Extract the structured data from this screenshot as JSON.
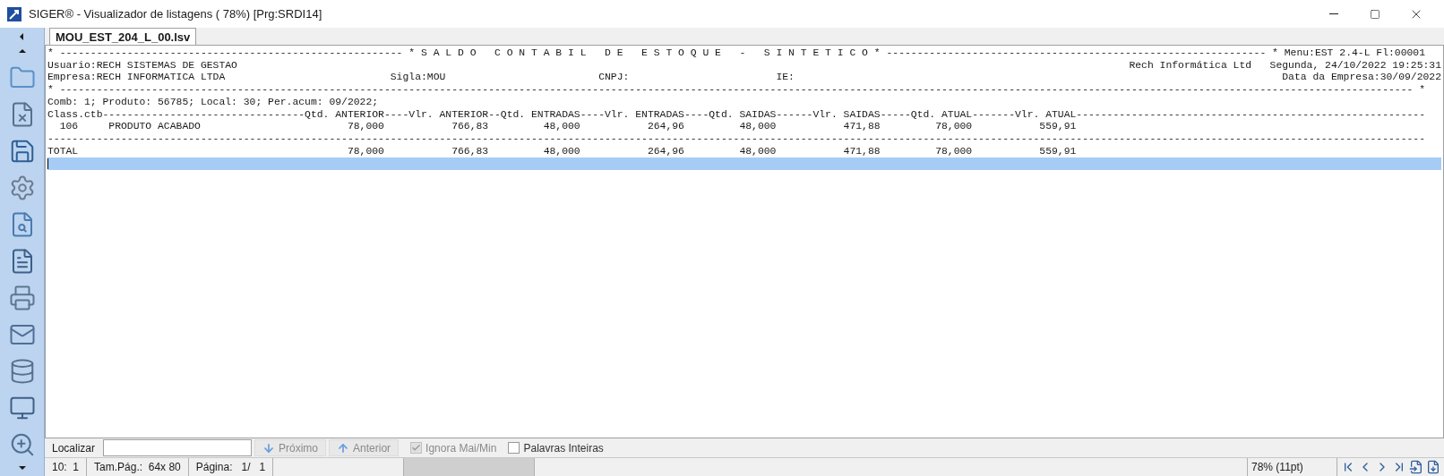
{
  "window": {
    "title": "SIGER® - Visualizador de listagens ( 78%) [Prg:SRDI14]"
  },
  "tabs": [
    {
      "label": "MOU_EST_204_L_00.lsv",
      "selected": true
    }
  ],
  "report": {
    "lines": [
      {
        "text": "* -------------------------------------------------------- * S A L D O   C O N T A B I L   D E   E S T O Q U E   -   S I N T E T I C O * -------------------------------------------------------------- * Menu:EST 2.4-L Fl:00001",
        "selected": false
      },
      {
        "text": "Usuario:RECH SISTEMAS DE GESTAO",
        "right": "Rech Informática Ltd   Segunda, 24/10/2022 19:25:31",
        "selected": false
      },
      {
        "text": "Empresa:RECH INFORMATICA LTDA                           Sigla:MOU                         CNPJ:                        IE:",
        "right": "Data da Empresa:30/09/2022",
        "selected": false
      },
      {
        "text": "* ----------------------------------------------------------------------------------------------------------------------------------------------------------------------------------------------------------------------------- *",
        "selected": false
      },
      {
        "text": "Comb: 1; Produto: 56785; Local: 30; Per.acum: 09/2022;",
        "selected": false
      },
      {
        "text": "Class.ctb---------------------------------Qtd. ANTERIOR----Vlr. ANTERIOR--Qtd. ENTRADAS----Vlr. ENTRADAS----Qtd. SAIDAS------Vlr. SAIDAS-----Qtd. ATUAL-------Vlr. ATUAL---------------------------------------------------------",
        "selected": false
      },
      {
        "text": "  106     PRODUTO ACABADO                        78,000           766,83         48,000           264,96         48,000           471,88         78,000           559,91",
        "selected": false
      },
      {
        "text": "---------------------------------------------------------------------------------------------------------------------------------------------------------------------------------------------------------------------------------",
        "selected": false
      },
      {
        "text": "TOTAL                                            78,000           766,83         48,000           264,96         48,000           471,88         78,000           559,91",
        "selected": false
      },
      {
        "selected": true
      }
    ]
  },
  "find_bar": {
    "label": "Localizar",
    "buttons": [
      {
        "label": "Próximo",
        "kind": "down",
        "disabled": true
      },
      {
        "label": "Anterior",
        "kind": "up",
        "disabled": true
      }
    ],
    "options": [
      {
        "label": "Ignora Mai/Min",
        "checked": true,
        "disabled": true
      },
      {
        "label": "Palavras Inteiras",
        "checked": false,
        "disabled": false
      }
    ]
  },
  "status_bar": {
    "cells": [
      "10:  1",
      "Tam.Pág.:  64x 80",
      "Página:   1/   1"
    ],
    "zoom": "78% (11pt)"
  }
}
